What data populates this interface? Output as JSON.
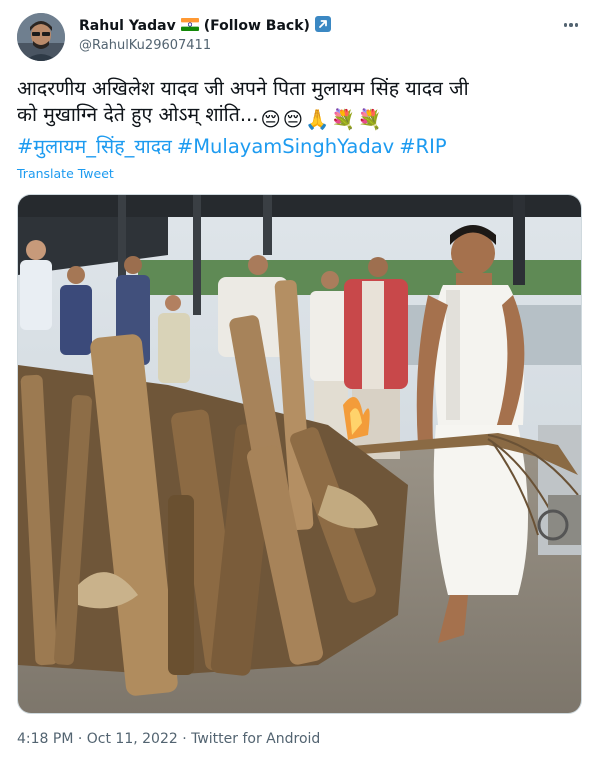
{
  "author": {
    "name": "Rahul Yadav",
    "flag": "🇮🇳",
    "follow_back": "(Follow Back)",
    "follow_icon": "arrow-up-right-icon",
    "handle": "@RahulKu29607411"
  },
  "menu_icon": "more-options-icon",
  "tweet": {
    "line1": "आदरणीय अखिलेश यादव जी अपने पिता मुलायम सिंह यादव जी",
    "line2": "को मुखाग्नि देते हुए ओऽम् शांति...",
    "emojis": [
      "😔",
      "😔",
      "🙏",
      "💐",
      "💐"
    ],
    "hashtags": [
      "#मुलायम_सिंह_यादव",
      "#MulayamSinghYadav",
      "#RIP"
    ]
  },
  "translate_label": "Translate Tweet",
  "footer": "4:18 PM · Oct 11, 2022 · Twitter for Android",
  "colors": {
    "link": "#1d9bf0",
    "muted": "#536471",
    "text": "#0f1419"
  }
}
